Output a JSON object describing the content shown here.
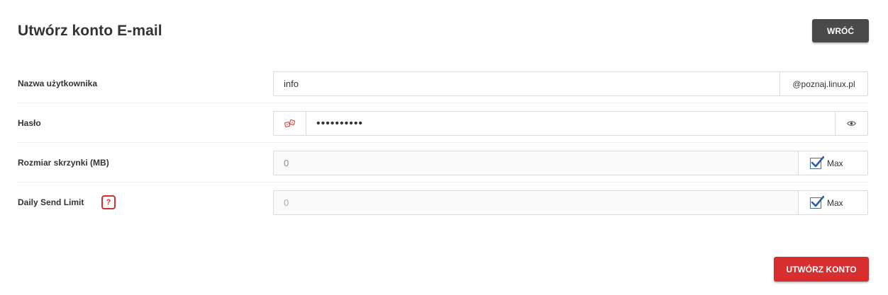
{
  "header": {
    "title": "Utwórz konto E-mail",
    "back_label": "WRÓĆ"
  },
  "form": {
    "username": {
      "label": "Nazwa użytkownika",
      "value": "info",
      "domain_suffix": "@poznaj.linux.pl"
    },
    "password": {
      "label": "Hasło",
      "value": "••••••••••",
      "generate_icon": "dice-icon",
      "toggle_icon": "eye-icon"
    },
    "mailbox_size": {
      "label": "Rozmiar skrzynki (MB)",
      "value": "0",
      "max_label": "Max",
      "max_checked": true
    },
    "daily_send_limit": {
      "label": "Daily Send Limit",
      "help": "?",
      "value": "0",
      "max_label": "Max",
      "max_checked": true
    }
  },
  "footer": {
    "create_label": "UTWÓRZ KONTO"
  },
  "colors": {
    "primary_red": "#d72f2f",
    "dark_button": "#4a4a4a",
    "checkbox_blue": "#4a6fa5"
  }
}
